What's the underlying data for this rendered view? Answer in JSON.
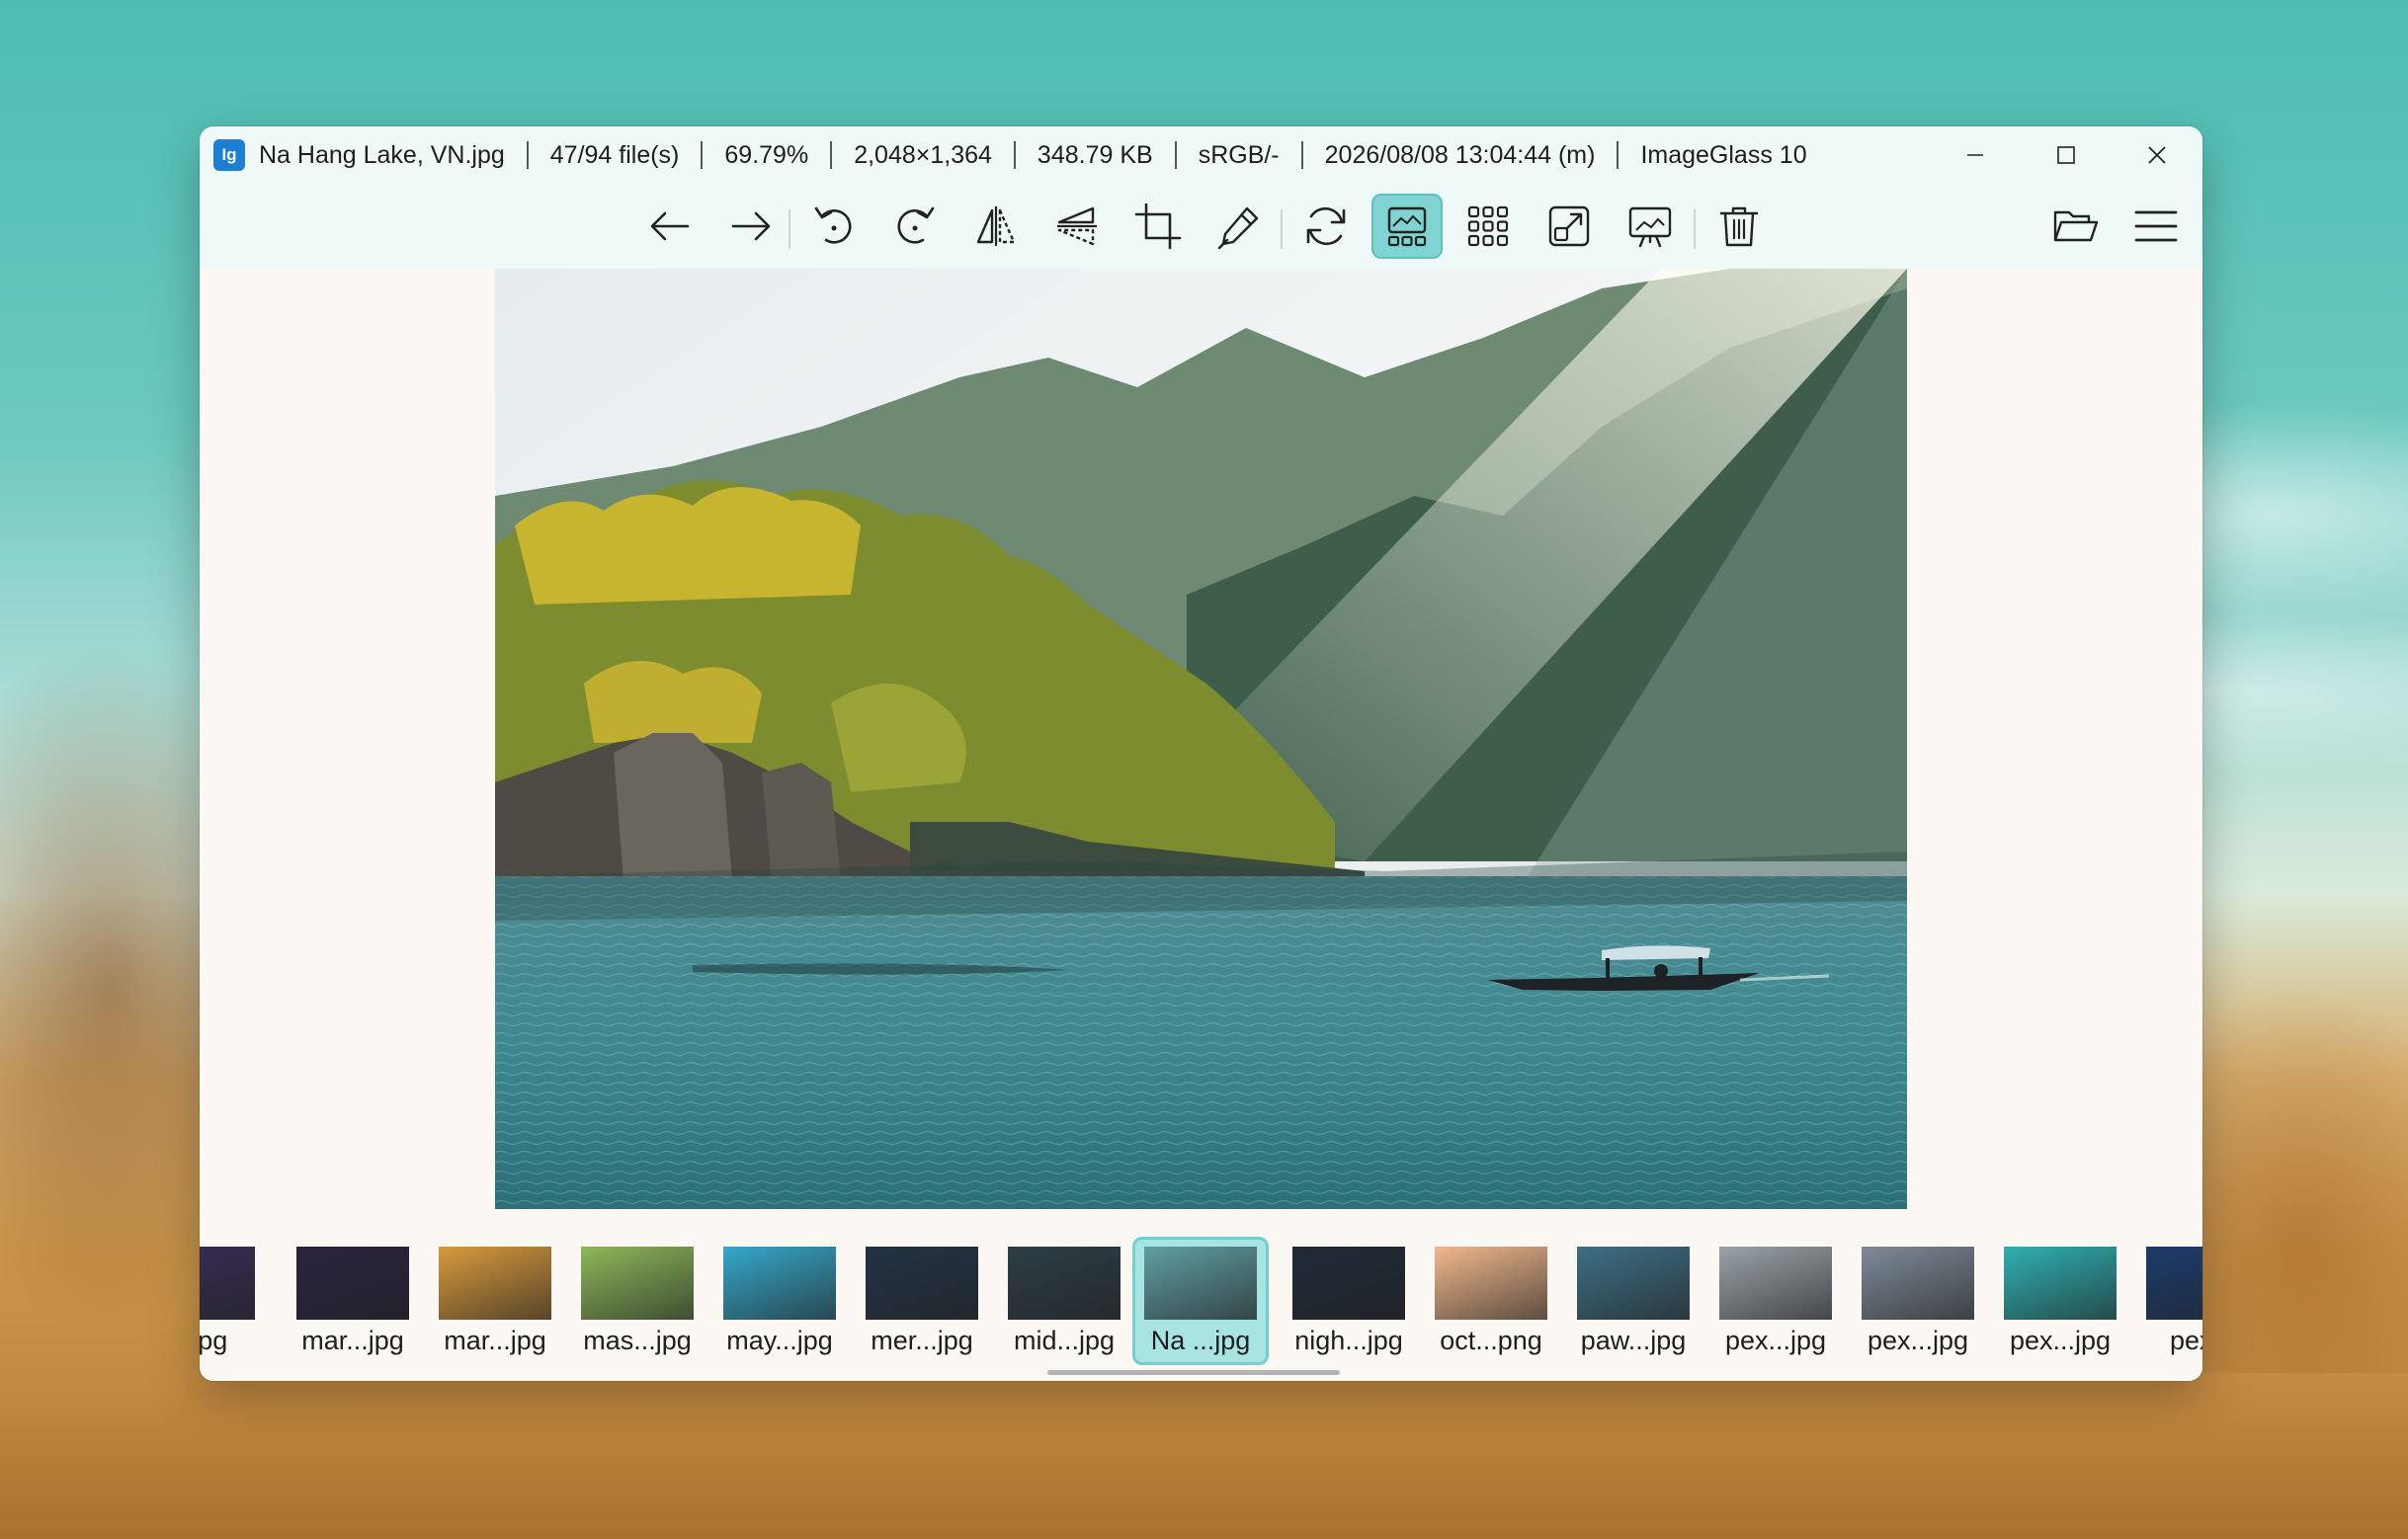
{
  "titlebar": {
    "filename": "Na Hang Lake, VN.jpg",
    "file_index": "47/94 file(s)",
    "zoom": "69.79%",
    "dimensions": "2,048×1,364",
    "file_size": "348.79 KB",
    "color_profile": "sRGB/-",
    "datetime": "2026/08/08 13:04:44 (m)",
    "app_name": "ImageGlass 10",
    "logo_text": "Ig"
  },
  "toolbar": {
    "icons": [
      "arrow-left-icon",
      "arrow-right-icon",
      "rotate-left-icon",
      "rotate-right-icon",
      "flip-horizontal-icon",
      "flip-vertical-icon",
      "crop-icon",
      "color-picker-icon",
      "refresh-icon",
      "thumbnail-bar-icon",
      "gallery-grid-icon",
      "fullscreen-icon",
      "slideshow-icon",
      "delete-icon",
      "open-folder-icon",
      "menu-icon"
    ],
    "active": "thumbnail-bar-icon"
  },
  "thumbnails": [
    {
      "label": "...jpg",
      "color": "#3a2d5a"
    },
    {
      "label": "mar...jpg",
      "color": "#2a2340"
    },
    {
      "label": "mar...jpg",
      "color": "#d89a3c"
    },
    {
      "label": "mas...jpg",
      "color": "#8cb85a"
    },
    {
      "label": "may...jpg",
      "color": "#36a7c9"
    },
    {
      "label": "mer...jpg",
      "color": "#223346"
    },
    {
      "label": "mid...jpg",
      "color": "#2c3e46"
    },
    {
      "label": "Na ...jpg",
      "color": "#5f9ea3"
    },
    {
      "label": "nigh...jpg",
      "color": "#1f2a38"
    },
    {
      "label": "oct...png",
      "color": "#f1b88c"
    },
    {
      "label": "paw...jpg",
      "color": "#3d6f85"
    },
    {
      "label": "pex...jpg",
      "color": "#9aa3a8"
    },
    {
      "label": "pex...jpg",
      "color": "#7e8b98"
    },
    {
      "label": "pex...jpg",
      "color": "#2fb0b3"
    },
    {
      "label": "pex...",
      "color": "#1c3b6b"
    }
  ],
  "active_thumbnail_index": 7
}
